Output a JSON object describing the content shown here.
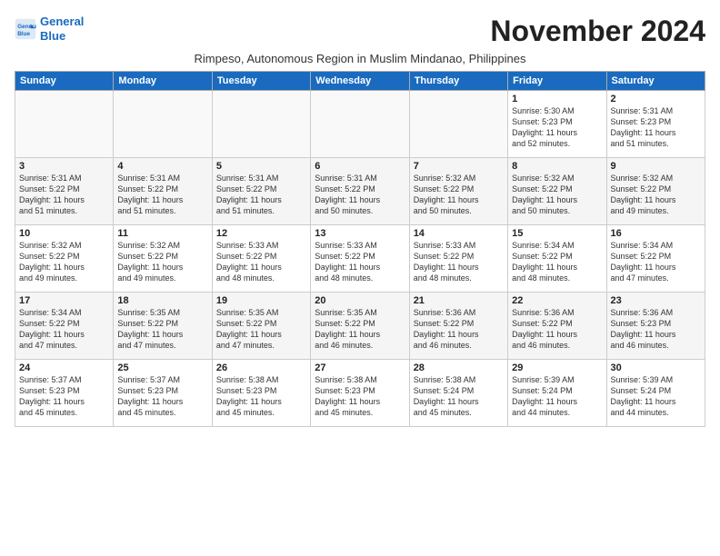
{
  "logo": {
    "line1": "General",
    "line2": "Blue"
  },
  "title": "November 2024",
  "subtitle": "Rimpeso, Autonomous Region in Muslim Mindanao, Philippines",
  "days_of_week": [
    "Sunday",
    "Monday",
    "Tuesday",
    "Wednesday",
    "Thursday",
    "Friday",
    "Saturday"
  ],
  "weeks": [
    [
      {
        "day": "",
        "info": ""
      },
      {
        "day": "",
        "info": ""
      },
      {
        "day": "",
        "info": ""
      },
      {
        "day": "",
        "info": ""
      },
      {
        "day": "",
        "info": ""
      },
      {
        "day": "1",
        "info": "Sunrise: 5:30 AM\nSunset: 5:23 PM\nDaylight: 11 hours\nand 52 minutes."
      },
      {
        "day": "2",
        "info": "Sunrise: 5:31 AM\nSunset: 5:23 PM\nDaylight: 11 hours\nand 51 minutes."
      }
    ],
    [
      {
        "day": "3",
        "info": "Sunrise: 5:31 AM\nSunset: 5:22 PM\nDaylight: 11 hours\nand 51 minutes."
      },
      {
        "day": "4",
        "info": "Sunrise: 5:31 AM\nSunset: 5:22 PM\nDaylight: 11 hours\nand 51 minutes."
      },
      {
        "day": "5",
        "info": "Sunrise: 5:31 AM\nSunset: 5:22 PM\nDaylight: 11 hours\nand 51 minutes."
      },
      {
        "day": "6",
        "info": "Sunrise: 5:31 AM\nSunset: 5:22 PM\nDaylight: 11 hours\nand 50 minutes."
      },
      {
        "day": "7",
        "info": "Sunrise: 5:32 AM\nSunset: 5:22 PM\nDaylight: 11 hours\nand 50 minutes."
      },
      {
        "day": "8",
        "info": "Sunrise: 5:32 AM\nSunset: 5:22 PM\nDaylight: 11 hours\nand 50 minutes."
      },
      {
        "day": "9",
        "info": "Sunrise: 5:32 AM\nSunset: 5:22 PM\nDaylight: 11 hours\nand 49 minutes."
      }
    ],
    [
      {
        "day": "10",
        "info": "Sunrise: 5:32 AM\nSunset: 5:22 PM\nDaylight: 11 hours\nand 49 minutes."
      },
      {
        "day": "11",
        "info": "Sunrise: 5:32 AM\nSunset: 5:22 PM\nDaylight: 11 hours\nand 49 minutes."
      },
      {
        "day": "12",
        "info": "Sunrise: 5:33 AM\nSunset: 5:22 PM\nDaylight: 11 hours\nand 48 minutes."
      },
      {
        "day": "13",
        "info": "Sunrise: 5:33 AM\nSunset: 5:22 PM\nDaylight: 11 hours\nand 48 minutes."
      },
      {
        "day": "14",
        "info": "Sunrise: 5:33 AM\nSunset: 5:22 PM\nDaylight: 11 hours\nand 48 minutes."
      },
      {
        "day": "15",
        "info": "Sunrise: 5:34 AM\nSunset: 5:22 PM\nDaylight: 11 hours\nand 48 minutes."
      },
      {
        "day": "16",
        "info": "Sunrise: 5:34 AM\nSunset: 5:22 PM\nDaylight: 11 hours\nand 47 minutes."
      }
    ],
    [
      {
        "day": "17",
        "info": "Sunrise: 5:34 AM\nSunset: 5:22 PM\nDaylight: 11 hours\nand 47 minutes."
      },
      {
        "day": "18",
        "info": "Sunrise: 5:35 AM\nSunset: 5:22 PM\nDaylight: 11 hours\nand 47 minutes."
      },
      {
        "day": "19",
        "info": "Sunrise: 5:35 AM\nSunset: 5:22 PM\nDaylight: 11 hours\nand 47 minutes."
      },
      {
        "day": "20",
        "info": "Sunrise: 5:35 AM\nSunset: 5:22 PM\nDaylight: 11 hours\nand 46 minutes."
      },
      {
        "day": "21",
        "info": "Sunrise: 5:36 AM\nSunset: 5:22 PM\nDaylight: 11 hours\nand 46 minutes."
      },
      {
        "day": "22",
        "info": "Sunrise: 5:36 AM\nSunset: 5:22 PM\nDaylight: 11 hours\nand 46 minutes."
      },
      {
        "day": "23",
        "info": "Sunrise: 5:36 AM\nSunset: 5:23 PM\nDaylight: 11 hours\nand 46 minutes."
      }
    ],
    [
      {
        "day": "24",
        "info": "Sunrise: 5:37 AM\nSunset: 5:23 PM\nDaylight: 11 hours\nand 45 minutes."
      },
      {
        "day": "25",
        "info": "Sunrise: 5:37 AM\nSunset: 5:23 PM\nDaylight: 11 hours\nand 45 minutes."
      },
      {
        "day": "26",
        "info": "Sunrise: 5:38 AM\nSunset: 5:23 PM\nDaylight: 11 hours\nand 45 minutes."
      },
      {
        "day": "27",
        "info": "Sunrise: 5:38 AM\nSunset: 5:23 PM\nDaylight: 11 hours\nand 45 minutes."
      },
      {
        "day": "28",
        "info": "Sunrise: 5:38 AM\nSunset: 5:24 PM\nDaylight: 11 hours\nand 45 minutes."
      },
      {
        "day": "29",
        "info": "Sunrise: 5:39 AM\nSunset: 5:24 PM\nDaylight: 11 hours\nand 44 minutes."
      },
      {
        "day": "30",
        "info": "Sunrise: 5:39 AM\nSunset: 5:24 PM\nDaylight: 11 hours\nand 44 minutes."
      }
    ]
  ]
}
